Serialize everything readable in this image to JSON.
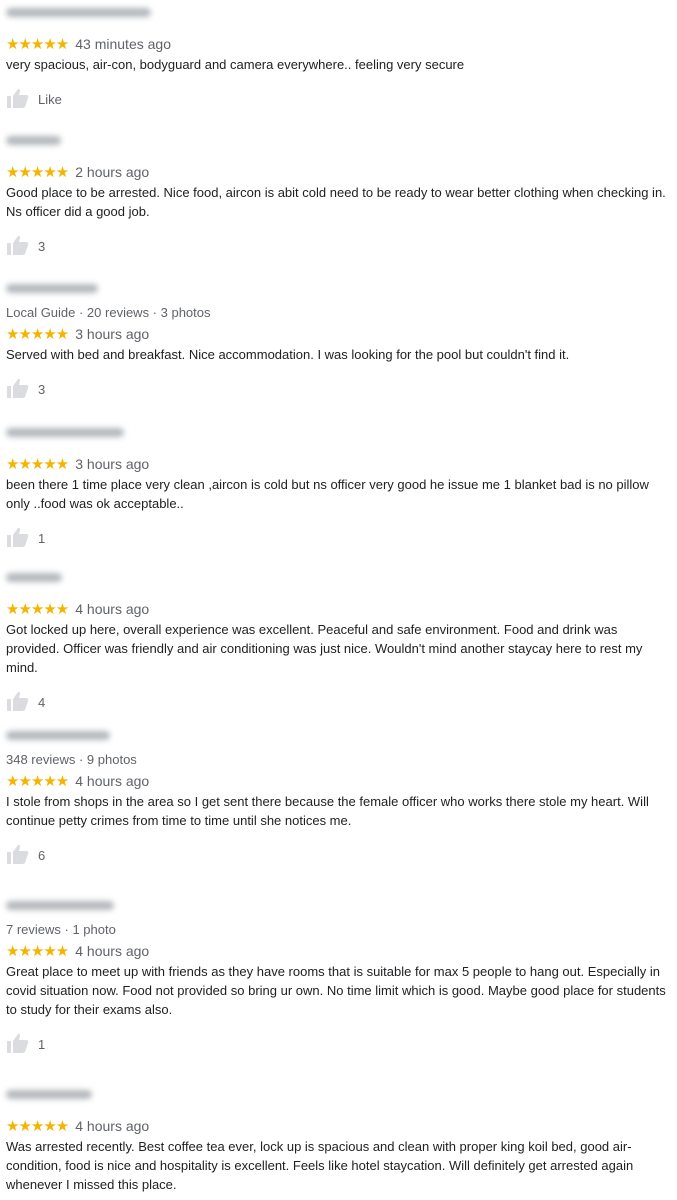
{
  "colors": {
    "star": "#f4b400",
    "muted": "#5f6368",
    "text": "#202124"
  },
  "icons": {
    "like": "thumbs-up-icon",
    "rating": "star-icon"
  },
  "reviews": [
    {
      "stars": "★★★★★",
      "rating": 5,
      "time": "43 minutes ago",
      "text": "very spacious, air-con, bodyguard and camera everywhere.. feeling very secure",
      "likes": "Like"
    },
    {
      "stars": "★★★★★",
      "rating": 5,
      "time": "2 hours ago",
      "text": "Good place to be arrested. Nice food, aircon is abit cold need to be ready to wear better clothing when checking in. Ns officer did a good job.",
      "likes": "3"
    },
    {
      "meta": "Local Guide · 20 reviews · 3 photos",
      "stars": "★★★★★",
      "rating": 5,
      "time": "3 hours ago",
      "text": "Served with bed and breakfast. Nice accommodation. I was looking for the pool but couldn't find it.",
      "likes": "3"
    },
    {
      "stars": "★★★★★",
      "rating": 5,
      "time": "3 hours ago",
      "text": "been there 1 time place very clean ,aircon is cold but ns officer very good he issue me 1 blanket bad is no pillow only ..food was ok acceptable..",
      "likes": "1"
    },
    {
      "stars": "★★★★★",
      "rating": 5,
      "time": "4 hours ago",
      "text": "Got locked up here, overall experience was excellent. Peaceful and safe environment. Food and drink was provided. Officer was friendly and air conditioning was just nice. Wouldn't mind another staycay here to rest my mind.",
      "likes": "4"
    },
    {
      "meta": "348 reviews · 9 photos",
      "stars": "★★★★★",
      "rating": 5,
      "time": "4 hours ago",
      "text": "I stole from shops in the area so I get sent there because the female officer who works there stole my heart. Will continue petty crimes from time to time until she notices me.",
      "likes": "6"
    },
    {
      "meta": "7 reviews · 1 photo",
      "stars": "★★★★★",
      "rating": 5,
      "time": "4 hours ago",
      "text": "Great place to meet up with friends as they have rooms that is suitable for max 5 people to hang out. Especially in covid situation now. Food not provided so bring ur own. No time limit which is good. Maybe good place for students to study for their exams also.",
      "likes": "1"
    },
    {
      "stars": "★★★★★",
      "rating": 5,
      "time": "4 hours ago",
      "text": "Was arrested recently. Best coffee tea ever, lock up is spacious and clean with proper king koil bed, good air-condition, food is nice and hospitality is excellent. Feels like hotel staycation. Will definitely get arrested again whenever I missed this place.",
      "likes": ""
    }
  ]
}
